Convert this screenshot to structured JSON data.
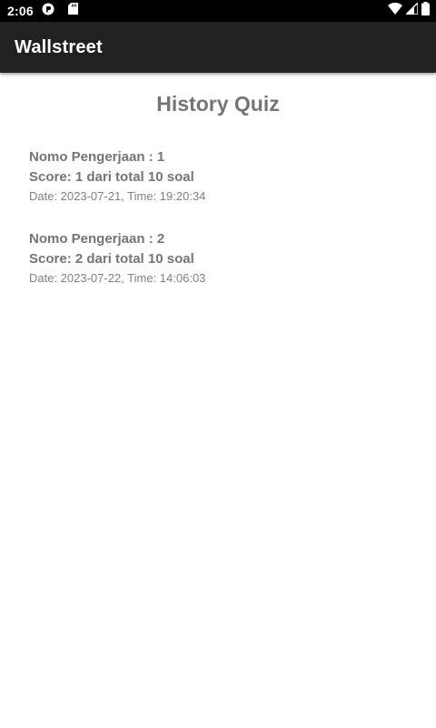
{
  "status_bar": {
    "time": "2:06",
    "left_icons": [
      "notification-app-icon",
      "sd-card-icon"
    ],
    "right_icons": [
      "wifi-icon",
      "cell-signal-icon",
      "battery-icon"
    ]
  },
  "app_bar": {
    "title": "Wallstreet"
  },
  "main": {
    "title": "History Quiz",
    "history": [
      {
        "attempt": "Nomo Pengerjaan : 1",
        "score": "Score: 1 dari total 10 soal",
        "datetime": "Date: 2023-07-21, Time: 19:20:34"
      },
      {
        "attempt": "Nomo Pengerjaan : 2",
        "score": "Score: 2 dari total 10 soal",
        "datetime": "Date: 2023-07-22, Time: 14:06:03"
      }
    ]
  },
  "colors": {
    "status_bar": "#000000",
    "app_bar": "#212121",
    "text_primary": "#757575",
    "text_secondary": "#808080",
    "background": "#ffffff"
  }
}
